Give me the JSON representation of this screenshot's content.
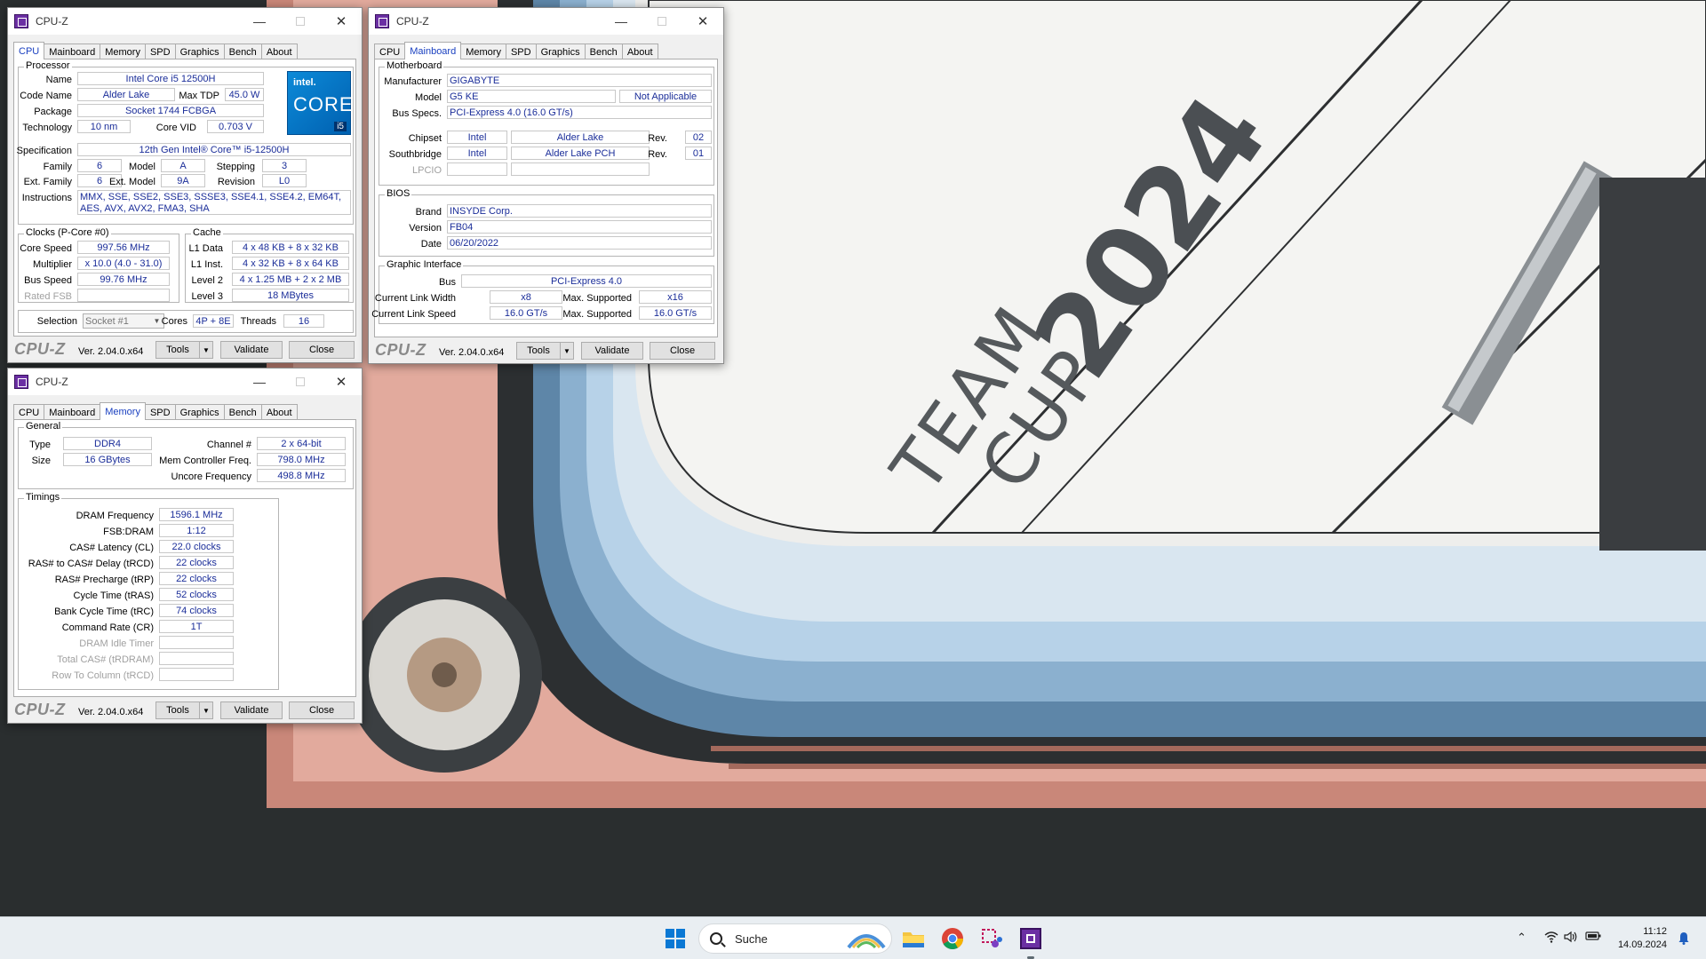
{
  "app_title": "CPU-Z",
  "tabs": [
    "CPU",
    "Mainboard",
    "Memory",
    "SPD",
    "Graphics",
    "Bench",
    "About"
  ],
  "footer": {
    "brand": "CPU-Z",
    "version": "Ver. 2.04.0.x64",
    "tools": "Tools",
    "validate": "Validate",
    "close": "Close"
  },
  "cpu": {
    "processor_group": "Processor",
    "name_label": "Name",
    "name": "Intel Core i5 12500H",
    "code_name_label": "Code Name",
    "code_name": "Alder Lake",
    "max_tdp_label": "Max TDP",
    "max_tdp": "45.0 W",
    "package_label": "Package",
    "package": "Socket 1744 FCBGA",
    "technology_label": "Technology",
    "technology": "10 nm",
    "core_vid_label": "Core VID",
    "core_vid": "0.703 V",
    "specification_label": "Specification",
    "specification": "12th Gen Intel® Core™ i5-12500H",
    "family_label": "Family",
    "family": "6",
    "model_label": "Model",
    "model": "A",
    "stepping_label": "Stepping",
    "stepping": "3",
    "ext_family_label": "Ext. Family",
    "ext_family": "6",
    "ext_model_label": "Ext. Model",
    "ext_model": "9A",
    "revision_label": "Revision",
    "revision": "L0",
    "instructions_label": "Instructions",
    "instructions": "MMX, SSE, SSE2, SSE3, SSSE3, SSE4.1, SSE4.2, EM64T, AES, AVX, AVX2, FMA3, SHA",
    "logo": {
      "brand": "intel.",
      "line": "CORE",
      "tier": "i5"
    },
    "clocks_group": "Clocks (P-Core #0)",
    "core_speed_label": "Core Speed",
    "core_speed": "997.56 MHz",
    "multiplier_label": "Multiplier",
    "multiplier": "x 10.0 (4.0 - 31.0)",
    "bus_speed_label": "Bus Speed",
    "bus_speed": "99.76 MHz",
    "rated_fsb_label": "Rated FSB",
    "cache_group": "Cache",
    "l1d_label": "L1 Data",
    "l1d": "4 x 48 KB + 8 x 32 KB",
    "l1i_label": "L1 Inst.",
    "l1i": "4 x 32 KB + 8 x 64 KB",
    "l2_label": "Level 2",
    "l2": "4 x 1.25 MB + 2 x 2 MB",
    "l3_label": "Level 3",
    "l3": "18 MBytes",
    "selection_label": "Selection",
    "selection": "Socket #1",
    "cores_label": "Cores",
    "cores": "4P + 8E",
    "threads_label": "Threads",
    "threads": "16"
  },
  "mainboard": {
    "motherboard_group": "Motherboard",
    "manufacturer_label": "Manufacturer",
    "manufacturer": "GIGABYTE",
    "model_label": "Model",
    "model": "G5 KE",
    "model_ext": "Not Applicable",
    "bus_specs_label": "Bus Specs.",
    "bus_specs": "PCI-Express 4.0 (16.0 GT/s)",
    "chipset_label": "Chipset",
    "chipset_vendor": "Intel",
    "chipset_name": "Alder Lake",
    "chipset_rev_label": "Rev.",
    "chipset_rev": "02",
    "southbridge_label": "Southbridge",
    "southbridge_vendor": "Intel",
    "southbridge_name": "Alder Lake PCH",
    "southbridge_rev_label": "Rev.",
    "southbridge_rev": "01",
    "lpcio_label": "LPCIO",
    "bios_group": "BIOS",
    "brand_label": "Brand",
    "brand": "INSYDE Corp.",
    "version_label": "Version",
    "version": "FB04",
    "date_label": "Date",
    "date": "06/20/2022",
    "graphic_group": "Graphic Interface",
    "bus_label": "Bus",
    "bus": "PCI-Express 4.0",
    "link_width_label": "Current Link Width",
    "link_width": "x8",
    "max_supported_label": "Max. Supported",
    "max_width": "x16",
    "link_speed_label": "Current Link Speed",
    "link_speed": "16.0 GT/s",
    "max_speed": "16.0 GT/s"
  },
  "memory": {
    "general_group": "General",
    "type_label": "Type",
    "type": "DDR4",
    "size_label": "Size",
    "size": "16 GBytes",
    "channel_label": "Channel #",
    "channel": "2 x 64-bit",
    "mem_ctrl_label": "Mem Controller Freq.",
    "mem_ctrl": "798.0 MHz",
    "uncore_label": "Uncore Frequency",
    "uncore": "498.8 MHz",
    "timings_group": "Timings",
    "timings": [
      {
        "label": "DRAM Frequency",
        "value": "1596.1 MHz",
        "disabled": false
      },
      {
        "label": "FSB:DRAM",
        "value": "1:12",
        "disabled": false
      },
      {
        "label": "CAS# Latency (CL)",
        "value": "22.0 clocks",
        "disabled": false
      },
      {
        "label": "RAS# to CAS# Delay (tRCD)",
        "value": "22 clocks",
        "disabled": false
      },
      {
        "label": "RAS# Precharge (tRP)",
        "value": "22 clocks",
        "disabled": false
      },
      {
        "label": "Cycle Time (tRAS)",
        "value": "52 clocks",
        "disabled": false
      },
      {
        "label": "Bank Cycle Time (tRC)",
        "value": "74 clocks",
        "disabled": false
      },
      {
        "label": "Command Rate (CR)",
        "value": "1T",
        "disabled": false
      },
      {
        "label": "DRAM Idle Timer",
        "value": "",
        "disabled": true
      },
      {
        "label": "Total CAS# (tRDRAM)",
        "value": "",
        "disabled": true
      },
      {
        "label": "Row To Column (tRCD)",
        "value": "",
        "disabled": true
      }
    ]
  },
  "wallpaper": {
    "line1": "TEAM",
    "line2": "CUP",
    "year": "2024"
  },
  "taskbar": {
    "search_placeholder": "Suche",
    "time": "11:12",
    "date": "14.09.2024",
    "accent": "#0a78d4"
  }
}
